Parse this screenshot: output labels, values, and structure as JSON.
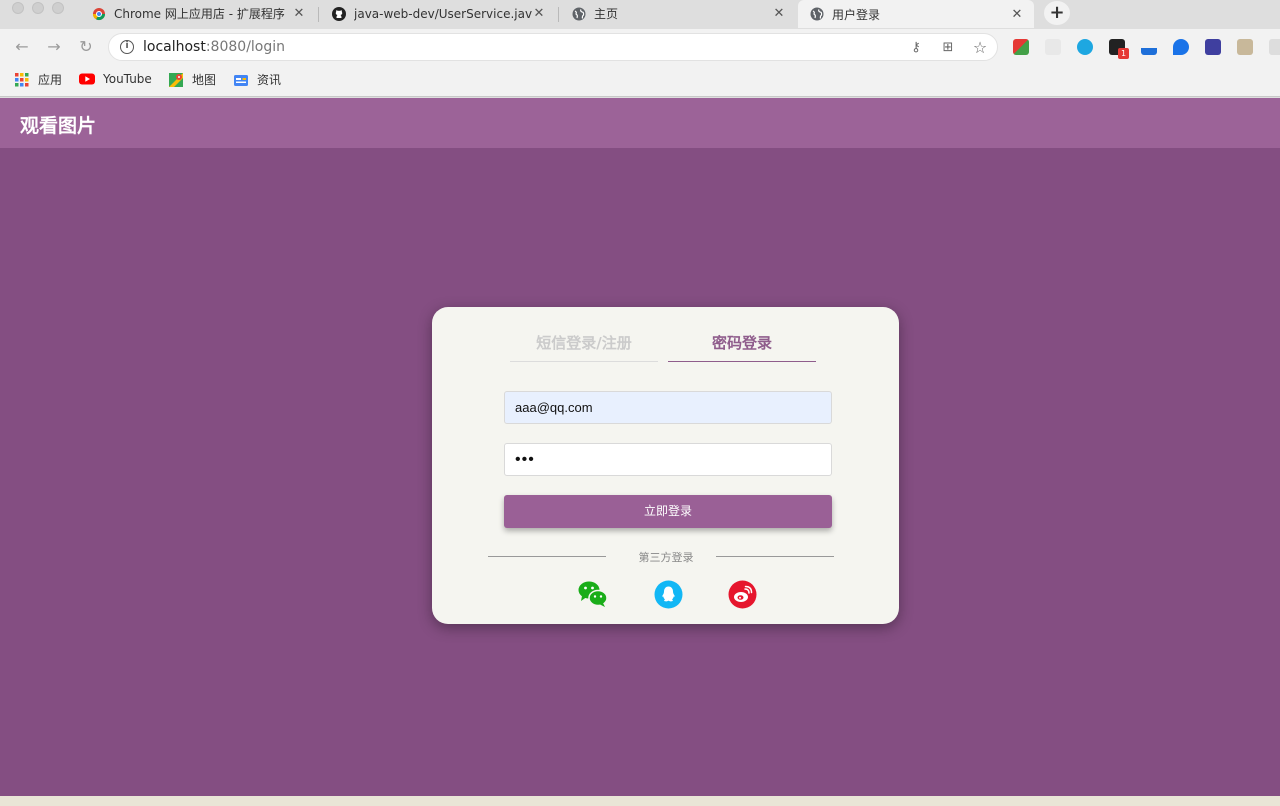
{
  "browser": {
    "tabs": [
      {
        "title": "Chrome 网上应用店 - 扩展程序",
        "active": false
      },
      {
        "title": "java-web-dev/UserService.java",
        "active": false
      },
      {
        "title": "主页",
        "active": false
      },
      {
        "title": "用户登录",
        "active": true
      }
    ],
    "url_host": "localhost",
    "url_path": ":8080/login",
    "bookmarks": [
      {
        "label": "应用",
        "icon": "apps-grid-icon"
      },
      {
        "label": "YouTube",
        "icon": "youtube-icon"
      },
      {
        "label": "地图",
        "icon": "maps-icon"
      },
      {
        "label": "资讯",
        "icon": "news-icon"
      }
    ],
    "extension_badge": "1"
  },
  "page": {
    "brand": "观看图片",
    "login_tabs": {
      "sms": "短信登录/注册",
      "password": "密码登录",
      "active": "password"
    },
    "email_value": "aaa@qq.com",
    "password_mask": "•••",
    "submit_label": "立即登录",
    "third_party_label": "第三方登录",
    "social": [
      "wechat-icon",
      "qq-icon",
      "weibo-icon"
    ]
  },
  "colors": {
    "page_bg": "#844e82",
    "header_bg": "#9c6398",
    "accent": "#9a6096",
    "wechat": "#1aad19",
    "qq": "#12b7f5",
    "weibo": "#e6162d"
  }
}
